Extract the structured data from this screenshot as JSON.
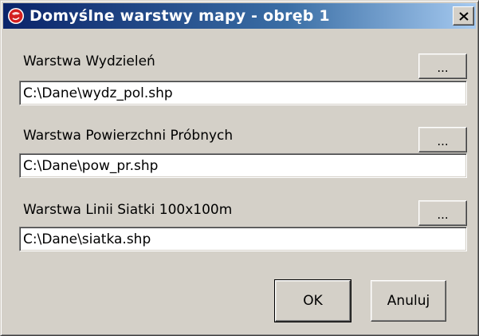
{
  "window": {
    "title": "Domyślne warstwy mapy - obręb 1",
    "app_icon": "red-globe-icon",
    "close_icon": "close-icon"
  },
  "layers": [
    {
      "label": "Warstwa Wydzieleń",
      "value": "C:\\Dane\\wydz_pol.shp",
      "browse_label": "..."
    },
    {
      "label": "Warstwa Powierzchni Próbnych",
      "value": "C:\\Dane\\pow_pr.shp",
      "browse_label": "..."
    },
    {
      "label": "Warstwa Linii Siatki 100x100m",
      "value": "C:\\Dane\\siatka.shp",
      "browse_label": "..."
    }
  ],
  "buttons": {
    "ok_label": "OK",
    "cancel_label": "Anuluj"
  },
  "colors": {
    "face": "#d4d0c8",
    "title_gradient_start": "#0a246a",
    "title_gradient_end": "#a6caf0",
    "icon_red": "#d42020"
  }
}
